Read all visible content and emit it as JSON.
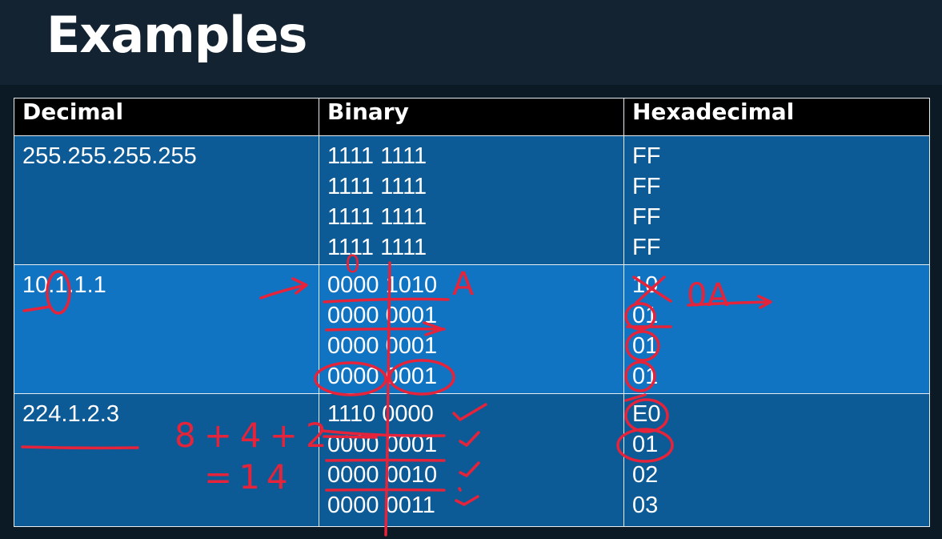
{
  "title": "Examples",
  "table": {
    "headers": [
      "Decimal",
      "Binary",
      "Hexadecimal"
    ],
    "rows": [
      {
        "decimal": "255.255.255.255",
        "binary": [
          "1111 1111",
          "1111 1111",
          "1111 1111",
          "1111 1111"
        ],
        "hex": [
          "FF",
          "FF",
          "FF",
          "FF"
        ]
      },
      {
        "decimal": "10.1.1.1",
        "binary": [
          "0000 1010",
          "0000 0001",
          "0000 0001",
          "0000 0001"
        ],
        "hex": [
          "10",
          "01",
          "01",
          "01"
        ]
      },
      {
        "decimal": "224.1.2.3",
        "binary": [
          "1110 0000",
          "0000 0001",
          "0000 0010",
          "0000 0011"
        ],
        "hex": [
          "E0",
          "01",
          "02",
          "03"
        ]
      }
    ]
  },
  "annotations": {
    "hex_correction": "0A",
    "nibble_letter": "A",
    "nibble_zero": "0",
    "sum_expression": "8+4+2",
    "sum_result": "=14"
  },
  "colors": {
    "header_bg": "#132332",
    "table_header_bg": "#000000",
    "row_dark": "#0c5a96",
    "row_light": "#1174c3",
    "ink": "#e5233a"
  }
}
